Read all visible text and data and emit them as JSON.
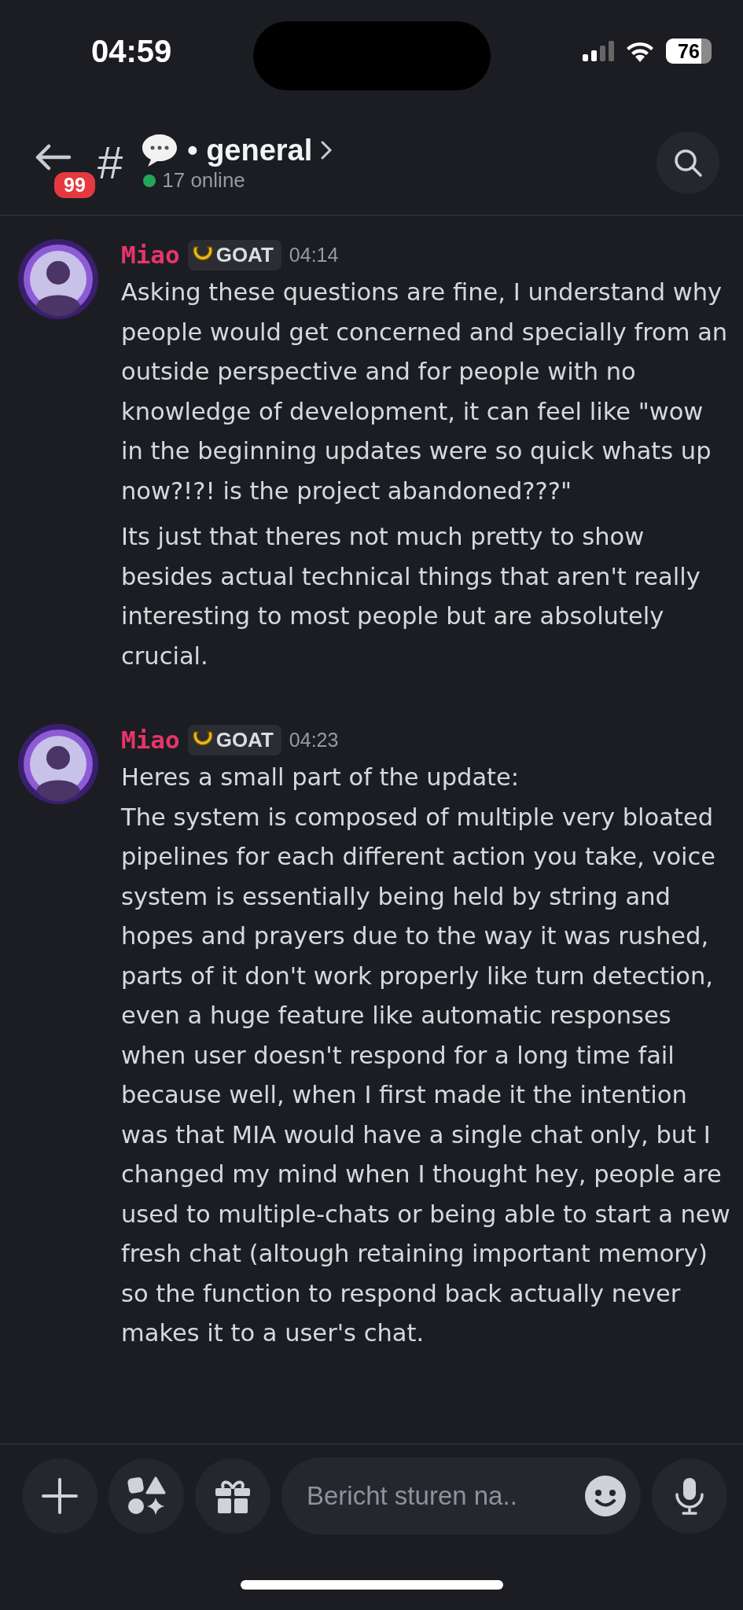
{
  "status_bar": {
    "time": "04:59",
    "battery": "76"
  },
  "header": {
    "unread_badge": "99",
    "channel_prefix": "#",
    "channel_name": "• general",
    "online": "17 online"
  },
  "messages": [
    {
      "author": "Miao",
      "role_badge": "GOAT",
      "time": "04:14",
      "paragraphs": [
        "Asking these questions are fine, I understand why people would get concerned and specially from an outside perspective and for people with no knowledge of development, it can feel like \"wow in the beginning updates were so quick whats up now?!?! is the project abandoned???\"",
        "Its just that theres not much pretty to show besides actual technical things that aren't really interesting to most people but are absolutely crucial."
      ]
    },
    {
      "author": "Miao",
      "role_badge": "GOAT",
      "time": "04:23",
      "paragraphs": [
        "Heres a small part of the update:\nThe system is composed of multiple very bloated pipelines for each different action you take, voice system is essentially being held by string and hopes and prayers due to the way it was rushed, parts of it don't work properly like turn detection, even a huge feature like automatic responses when user doesn't respond for a long time fail because well, when I first made it the intention was that MIA would have a single chat only, but I changed my mind when I thought hey, people are used to multiple-chats or being able to start a new fresh chat (altough retaining important memory) so the function to respond back actually never makes it to a user's chat."
      ]
    }
  ],
  "composer": {
    "placeholder": "Bericht sturen na.."
  }
}
